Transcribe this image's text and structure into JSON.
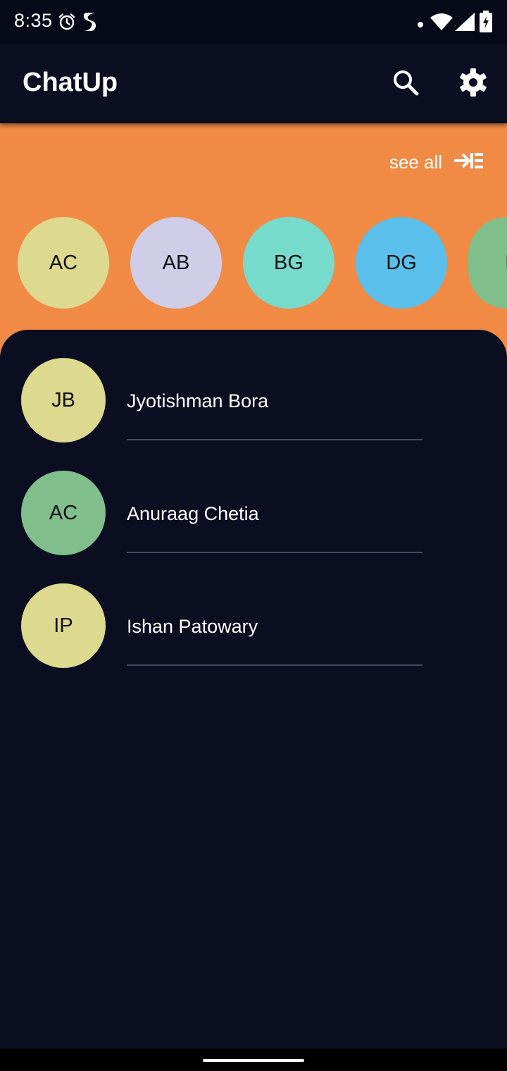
{
  "status_bar": {
    "time": "8:35",
    "icons": [
      "alarm-clock-icon",
      "app-s-icon",
      "notification-dot-icon",
      "wifi-icon",
      "cell-signal-icon",
      "battery-icon"
    ]
  },
  "app_bar": {
    "title": "ChatUp",
    "actions": [
      "search-icon",
      "settings-gear-icon"
    ]
  },
  "stories": {
    "see_all_label": "see all",
    "see_all_icon": "arrow-into-list-icon",
    "background_color": "#f08a45",
    "avatars": [
      {
        "initials": "AC",
        "color": "#ddd98f"
      },
      {
        "initials": "AB",
        "color": "#cfcde8"
      },
      {
        "initials": "BG",
        "color": "#76dbcc"
      },
      {
        "initials": "DG",
        "color": "#5bbfec"
      },
      {
        "initials": "I",
        "color": "#80bf8c"
      }
    ]
  },
  "contacts": [
    {
      "initials": "JB",
      "name": "Jyotishman Bora",
      "color": "#ddd98f"
    },
    {
      "initials": "AC",
      "name": "Anuraag Chetia",
      "color": "#80bf8c"
    },
    {
      "initials": "IP",
      "name": "Ishan Patowary",
      "color": "#ddd98f"
    }
  ],
  "colors": {
    "background": "#0a0e20",
    "status_bar": "#060a18",
    "accent": "#f08a45",
    "divider": "#454a5e"
  }
}
